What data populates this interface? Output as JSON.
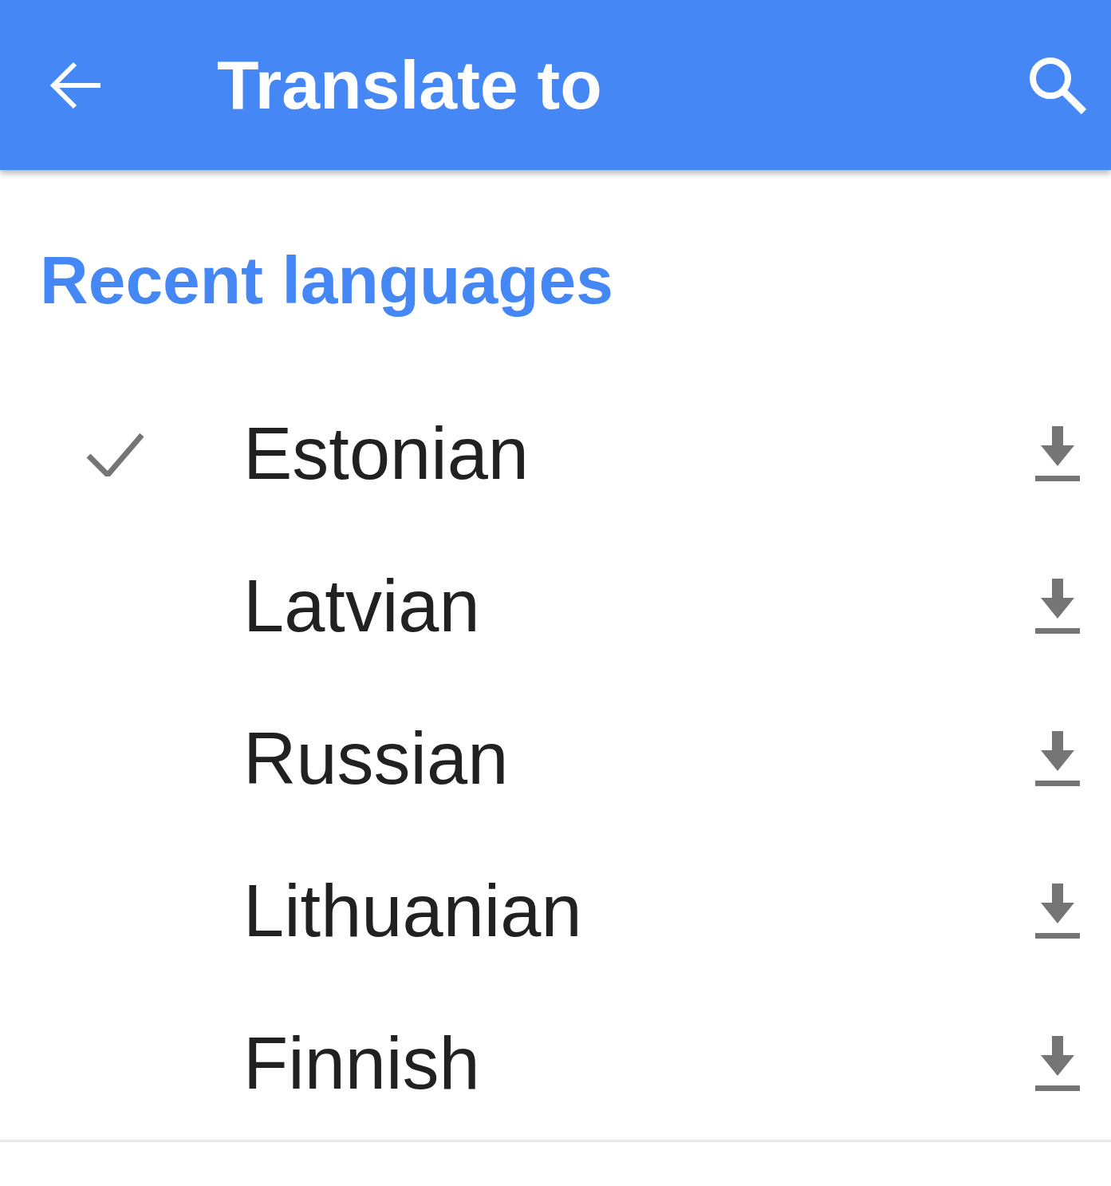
{
  "app_bar": {
    "title": "Translate to"
  },
  "section": {
    "title": "Recent languages"
  },
  "languages": [
    {
      "name": "Estonian",
      "selected": true
    },
    {
      "name": "Latvian",
      "selected": false
    },
    {
      "name": "Russian",
      "selected": false
    },
    {
      "name": "Lithuanian",
      "selected": false
    },
    {
      "name": "Finnish",
      "selected": false
    }
  ]
}
